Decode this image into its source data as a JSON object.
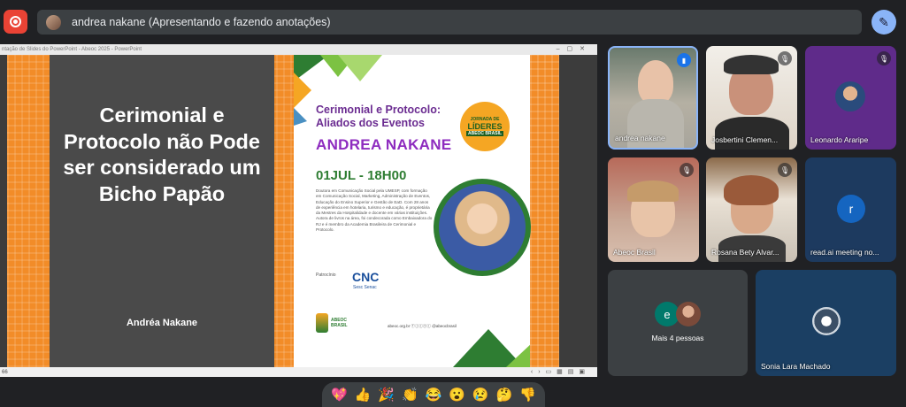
{
  "presenter_bar": {
    "text": "andrea nakane (Apresentando e fazendo anotações)"
  },
  "icons": {
    "record": "record-icon",
    "annotate": "pencil-sparkle-icon"
  },
  "colors": {
    "record_red": "#ea4335",
    "accent_blue": "#8ab4f8",
    "slide_orange": "#f28c28",
    "slide_purple": "#8e2cbf",
    "slide_green": "#2e7d32"
  },
  "shared_screen": {
    "window_title": "ntação de Slides do PowerPoint - Abeoc 2025 - PowerPoint",
    "status_left": "66",
    "left_slide": {
      "title": "Cerimonial e Protocolo não Pode ser considerado um Bicho Papão",
      "author": "Andréa Nakane"
    },
    "right_slide": {
      "event_title": "Cerimonial e Protocolo: Aliados dos Eventos",
      "speaker": "ANDREA NAKANE",
      "date": "01JUL - 18H00",
      "bio": "Doutora em Comunicação Social pela UMESP, com formação em Comunicação Social, Marketing, Administração de Eventos, Educação do Ensino Superior e Gestão de EaD. Com 28 anos de experiência em hotelaria, turismo e educação, é proprietária da Mestres da Hospitalidade e docente em várias instituições. Autora de livros na área, foi condecorada como Embaixadora do RJ e é membro da Academia Brasileira de Cerimonial e Protocolo.",
      "badge_line1": "JORNADA DE",
      "badge_line2": "LÍDERES",
      "badge_line3": "ABEOC BRASIL",
      "sponsor_label": "Patrocínio",
      "sponsor_name": "CNC",
      "sponsor_sub": "Sesc Senac",
      "abeoc_logo_text": "ABEOC BRASIL",
      "footer_links": "abeoc.org.br  ⓕⓘⓘⓨⓘ  @abeocbrasil"
    }
  },
  "participants": [
    {
      "name": "andrea nakane",
      "state": "speaking"
    },
    {
      "name": "Josbertini Clemen...",
      "state": "muted"
    },
    {
      "name": "Leonardo Araripe",
      "state": "muted"
    },
    {
      "name": "Abeoc Brasil",
      "state": "muted"
    },
    {
      "name": "Rosana Bety Alvar...",
      "state": "muted"
    },
    {
      "name": "read.ai meeting no...",
      "state": "",
      "initial": "r"
    },
    {
      "name": "Mais 4 pessoas",
      "initial": "e"
    },
    {
      "name": "Sonia Lara Machado",
      "state": ""
    }
  ],
  "reactions": [
    "💖",
    "👍",
    "🎉",
    "👏",
    "😂",
    "😮",
    "😢",
    "🤔",
    "👎"
  ]
}
